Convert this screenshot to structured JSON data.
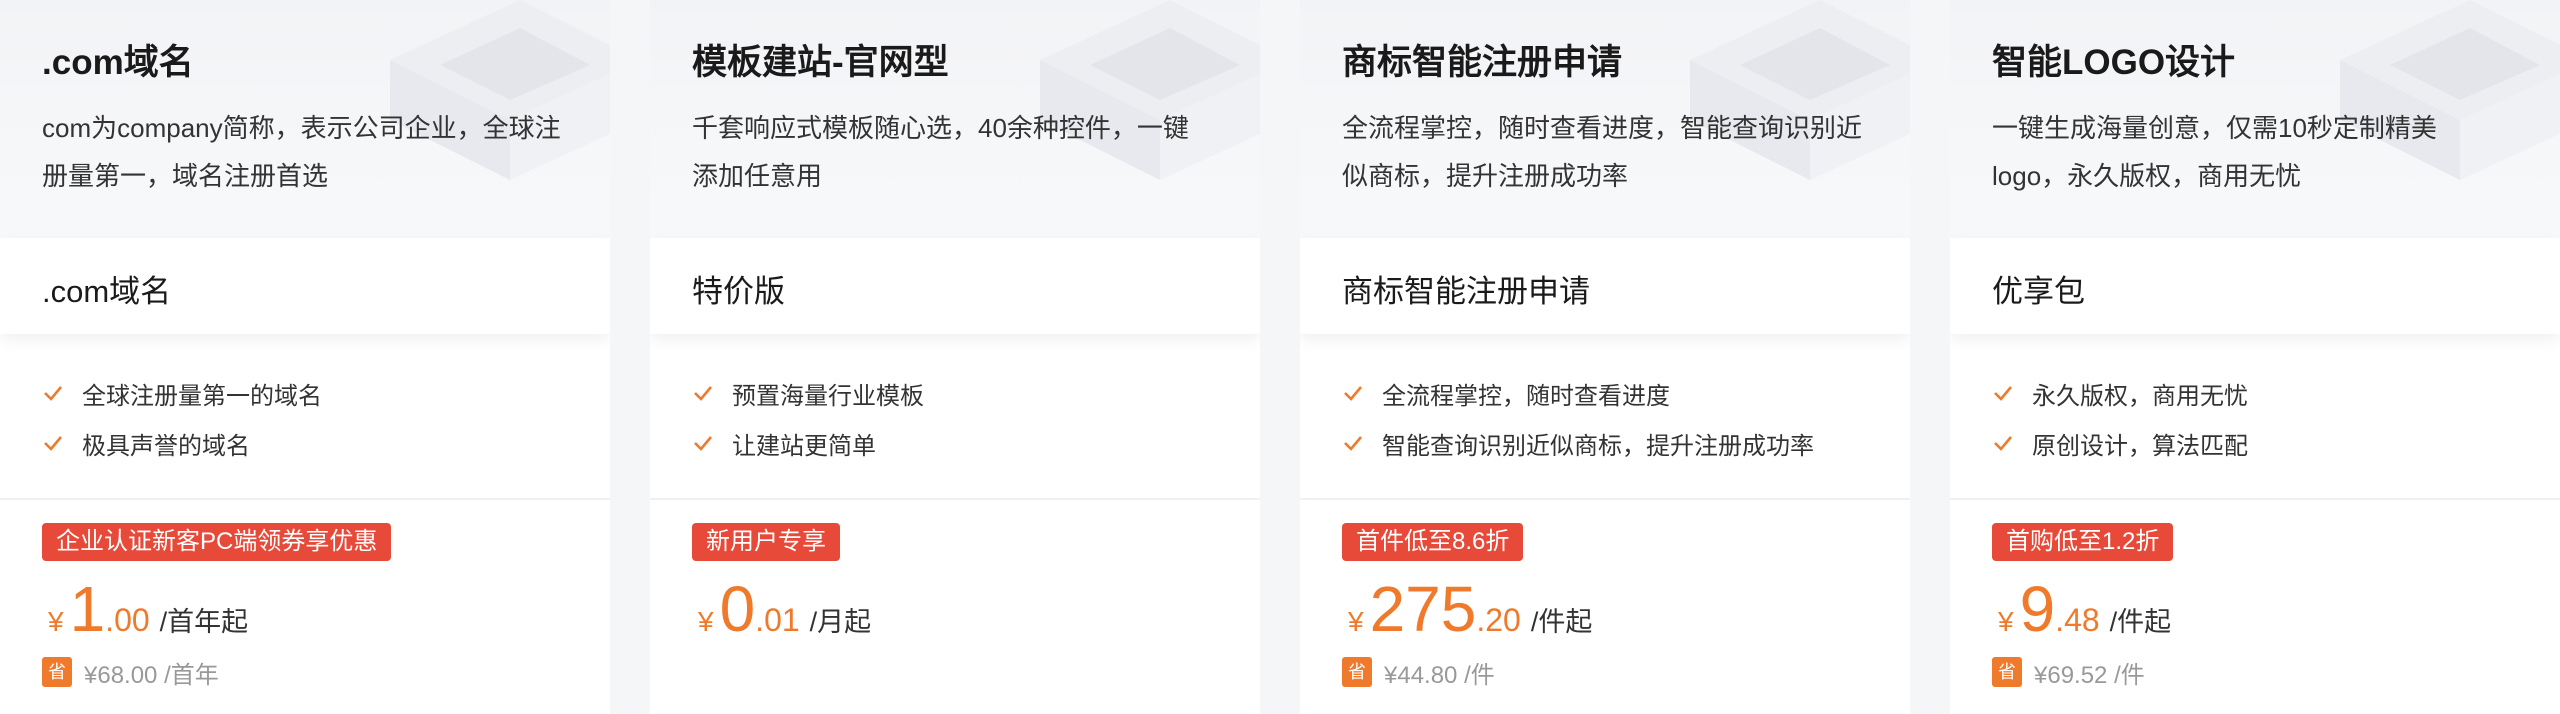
{
  "colors": {
    "accent": "#f07a2b",
    "promo": "#e84a3a",
    "text": "#1a1a1a",
    "muted": "#999999"
  },
  "cards": [
    {
      "title": ".com域名",
      "desc": "com为company简称，表示公司企业，全球注册量第一，域名注册首选",
      "plan": ".com域名",
      "features": [
        "全球注册量第一的域名",
        "极具声誉的域名"
      ],
      "promo": "企业认证新客PC端领券享优惠",
      "currency": "¥",
      "price_int": "1",
      "price_dec": ".00",
      "price_unit": "/首年起",
      "save_label": "省",
      "orig_price": "¥68.00 /首年"
    },
    {
      "title": "模板建站-官网型",
      "desc": "千套响应式模板随心选，40余种控件，一键添加任意用",
      "plan": "特价版",
      "features": [
        "预置海量行业模板",
        "让建站更简单"
      ],
      "promo": "新用户专享",
      "currency": "¥",
      "price_int": "0",
      "price_dec": ".01",
      "price_unit": "/月起",
      "save_label": "",
      "orig_price": ""
    },
    {
      "title": "商标智能注册申请",
      "desc": "全流程掌控，随时查看进度，智能查询识别近似商标，提升注册成功率",
      "plan": "商标智能注册申请",
      "features": [
        "全流程掌控，随时查看进度",
        "智能查询识别近似商标，提升注册成功率"
      ],
      "promo": "首件低至8.6折",
      "currency": "¥",
      "price_int": "275",
      "price_dec": ".20",
      "price_unit": "/件起",
      "save_label": "省",
      "orig_price": "¥44.80 /件"
    },
    {
      "title": "智能LOGO设计",
      "desc": "一键生成海量创意，仅需10秒定制精美logo，永久版权，商用无忧",
      "plan": "优享包",
      "features": [
        "永久版权，商用无忧",
        "原创设计，算法匹配"
      ],
      "promo": "首购低至1.2折",
      "currency": "¥",
      "price_int": "9",
      "price_dec": ".48",
      "price_unit": "/件起",
      "save_label": "省",
      "orig_price": "¥69.52 /件"
    }
  ]
}
